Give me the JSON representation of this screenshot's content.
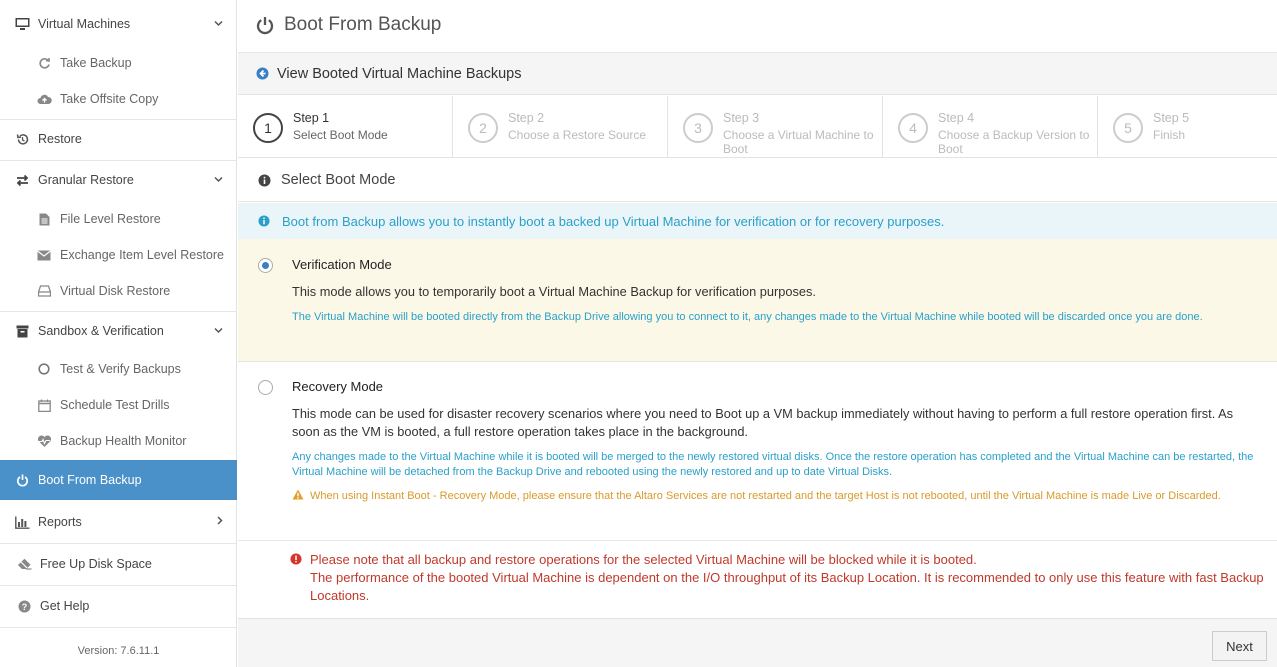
{
  "sidebar": {
    "items": [
      {
        "label": "Virtual Machines",
        "icon": "monitor-icon"
      },
      {
        "label": "Take Backup",
        "icon": "refresh-icon"
      },
      {
        "label": "Take Offsite Copy",
        "icon": "cloud-upload-icon"
      },
      {
        "label": "Restore",
        "icon": "history-icon"
      },
      {
        "label": "Granular Restore",
        "icon": "exchange-arrows-icon"
      },
      {
        "label": "File Level Restore",
        "icon": "file-icon"
      },
      {
        "label": "Exchange Item Level Restore",
        "icon": "envelope-icon"
      },
      {
        "label": "Virtual Disk Restore",
        "icon": "disk-icon"
      },
      {
        "label": "Sandbox & Verification",
        "icon": "archive-box-icon"
      },
      {
        "label": "Test & Verify Backups",
        "icon": "circle-icon"
      },
      {
        "label": "Schedule Test Drills",
        "icon": "calendar-icon"
      },
      {
        "label": "Backup Health Monitor",
        "icon": "heartbeat-icon"
      },
      {
        "label": "Boot From Backup",
        "icon": "power-icon"
      },
      {
        "label": "Reports",
        "icon": "bar-chart-icon"
      },
      {
        "label": "Free Up Disk Space",
        "icon": "eraser-icon"
      },
      {
        "label": "Get Help",
        "icon": "question-icon"
      }
    ],
    "version": "Version: 7.6.11.1"
  },
  "header": {
    "title": "Boot From Backup",
    "back_label": "View Booted Virtual Machine Backups"
  },
  "steps": [
    {
      "num": "1",
      "title": "Step 1",
      "sub": "Select Boot Mode"
    },
    {
      "num": "2",
      "title": "Step 2",
      "sub": "Choose a Restore Source"
    },
    {
      "num": "3",
      "title": "Step 3",
      "sub": "Choose a Virtual Machine to Boot"
    },
    {
      "num": "4",
      "title": "Step 4",
      "sub": "Choose a Backup Version to Boot"
    },
    {
      "num": "5",
      "title": "Step 5",
      "sub": "Finish"
    }
  ],
  "section": {
    "title": "Select Boot Mode",
    "info": "Boot from Backup allows you to instantly boot a backed up Virtual Machine for verification or for recovery purposes."
  },
  "verification": {
    "title": "Verification Mode",
    "desc": "This mode allows you to temporarily boot a Virtual Machine Backup for verification purposes.",
    "note": "The Virtual Machine will be booted directly from the Backup Drive allowing you to connect to it, any changes made to the Virtual Machine while booted will be discarded once you are done."
  },
  "recovery": {
    "title": "Recovery Mode",
    "desc": "This mode can be used for disaster recovery scenarios where you need to Boot up a VM backup immediately without having to perform a full restore operation first. As soon as the VM is booted, a full restore operation takes place in the background.",
    "note": "Any changes made to the Virtual Machine while it is booted will be merged to the newly restored virtual disks. Once the restore operation has completed and the Virtual Machine can be restarted, the Virtual Machine will be detached from the Backup Drive and rebooted using the newly restored and up to date Virtual Disks.",
    "warning": "When using Instant Boot - Recovery Mode, please ensure that the Altaro Services are not restarted and the target Host is not rebooted, until the Virtual Machine is made Live or Discarded."
  },
  "alert": {
    "line1": "Please note that all backup and restore operations for the selected Virtual Machine will be blocked while it is booted.",
    "line2": "The performance of the booted Virtual Machine is dependent on the I/O throughput of its Backup Location. It is recommended to only use this feature with fast Backup Locations."
  },
  "footer": {
    "next_label": "Next"
  },
  "colors": {
    "accent": "#4a90c9",
    "info": "#2aa0c8",
    "warning": "#d99a2b",
    "danger": "#c0392b",
    "selected_bg": "#fcf8e8"
  }
}
